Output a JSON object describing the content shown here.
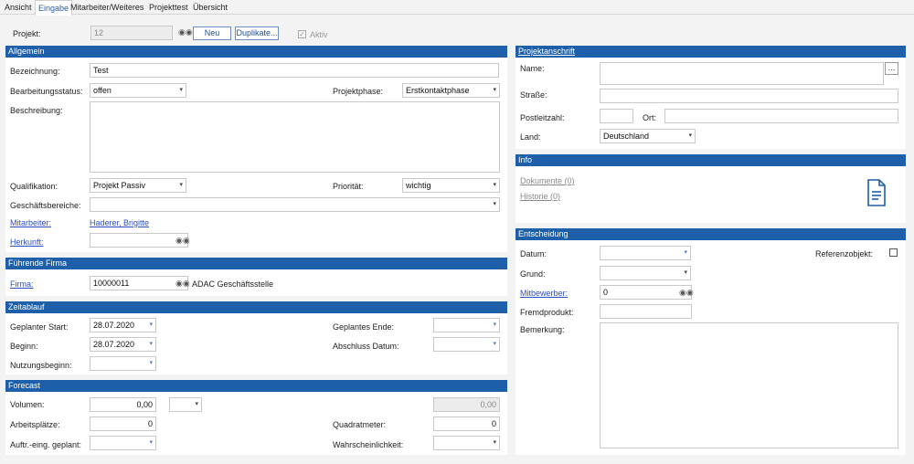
{
  "tabs": [
    "Ansicht",
    "Eingabe",
    "Mitarbeiter/Weiteres",
    "Projekttest",
    "Übersicht"
  ],
  "top": {
    "projekt_label": "Projekt:",
    "projekt_value": "12",
    "neu_label": "Neu",
    "duplikate_label": "Duplikate...",
    "aktiv_label": "Aktiv"
  },
  "allgemein": {
    "title": "Allgemein",
    "bezeichnung_label": "Bezeichnung:",
    "bezeichnung_value": "Test",
    "bearbeitungsstatus_label": "Bearbeitungsstatus:",
    "bearbeitungsstatus_value": "offen",
    "projektphase_label": "Projektphase:",
    "projektphase_value": "Erstkontaktphase",
    "beschreibung_label": "Beschreibung:",
    "qualifikation_label": "Qualifikation:",
    "qualifikation_value": "Projekt Passiv",
    "prioritaet_label": "Priorität:",
    "prioritaet_value": "wichtig",
    "geschaeftsbereiche_label": "Geschäftsbereiche:",
    "mitarbeiter_label": "Mitarbeiter:",
    "mitarbeiter_value": "Haderer, Brigitte",
    "herkunft_label": "Herkunft:"
  },
  "fuehrende_firma": {
    "title": "Führende Firma",
    "firma_label": "Firma:",
    "firma_value": "10000011",
    "firma_name": "ADAC Geschäftsstelle"
  },
  "zeitablauf": {
    "title": "Zeitablauf",
    "geplanter_start_label": "Geplanter Start:",
    "geplanter_start_value": "28.07.2020",
    "geplantes_ende_label": "Geplantes Ende:",
    "beginn_label": "Beginn:",
    "beginn_value": "28.07.2020",
    "abschluss_label": "Abschluss Datum:",
    "nutzungsbeginn_label": "Nutzungsbeginn:"
  },
  "forecast": {
    "title": "Forecast",
    "volumen_label": "Volumen:",
    "volumen_value": "0,00",
    "volumen_right_value": "0,00",
    "arbeitsplaetze_label": "Arbeitsplätze:",
    "arbeitsplaetze_value": "0",
    "quadratmeter_label": "Quadratmeter:",
    "quadratmeter_value": "0",
    "auftr_label": "Auftr.-eing. geplant:",
    "wahrscheinlichkeit_label": "Wahrscheinlichkeit:"
  },
  "projektanschrift": {
    "title": "Projektanschrift",
    "name_label": "Name:",
    "strasse_label": "Straße:",
    "plz_label": "Postleitzahl:",
    "ort_label": "Ort:",
    "land_label": "Land:",
    "land_value": "Deutschland",
    "ellipsis": "..."
  },
  "info": {
    "title": "Info",
    "dokumente": "Dokumente (0)",
    "historie": "Historie (0)"
  },
  "entscheidung": {
    "title": "Entscheidung",
    "datum_label": "Datum:",
    "referenzobjekt_label": "Referenzobjekt:",
    "grund_label": "Grund:",
    "mitbewerber_label": "Mitbewerber:",
    "mitbewerber_value": "0",
    "fremdprodukt_label": "Fremdprodukt:",
    "bemerkung_label": "Bemerkung:"
  },
  "icons": {
    "binoculars": "binoculars-icon",
    "dropdown": "chevron-down-icon",
    "document": "document-icon"
  },
  "colors": {
    "section_header": "#1d5fa8",
    "link": "#2a4fc6"
  }
}
